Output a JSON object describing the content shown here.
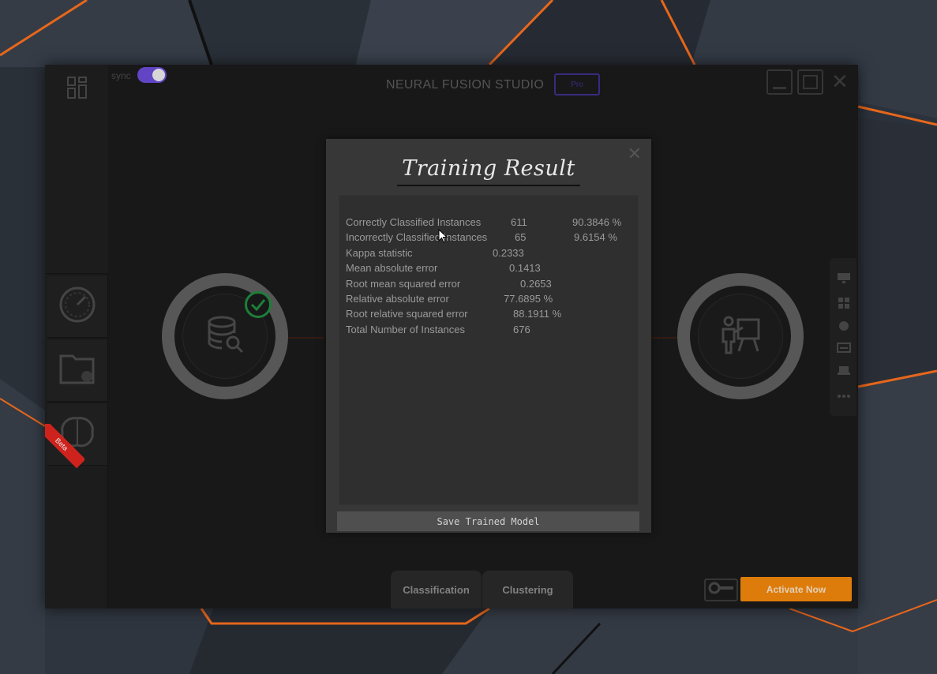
{
  "app": {
    "title": "NEURAL FUSION STUDIO",
    "badge": "Pro",
    "sync_label": "sync",
    "sync_on": true
  },
  "sidebar": {
    "beta_label": "Beta",
    "icons": [
      "apps-grid-icon",
      "speedometer-icon",
      "folder-chart-icon",
      "brain-icon"
    ]
  },
  "dialog": {
    "title": "Training Result",
    "close_symbol": "✕",
    "save_button": "Save Trained Model",
    "results": [
      {
        "label": "Correctly Classified Instances",
        "value": "611",
        "percent": "90.3846 %"
      },
      {
        "label": "Incorrectly Classified Instances",
        "value": "65",
        "percent": "9.6154 %"
      },
      {
        "label": "Kappa statistic",
        "value": "0.2333",
        "percent": ""
      },
      {
        "label": "Mean absolute error",
        "value": "0.1413",
        "percent": ""
      },
      {
        "label": "Root mean squared error",
        "value": "0.2653",
        "percent": ""
      },
      {
        "label": "Relative absolute error",
        "value": "77.6895 %",
        "percent": ""
      },
      {
        "label": "Root relative squared error",
        "value": "88.1911 %",
        "percent": ""
      },
      {
        "label": "Total Number of Instances",
        "value": "676",
        "percent": ""
      }
    ]
  },
  "bottom_tabs": {
    "classification": "Classification",
    "clustering": "Clustering"
  },
  "activate_button": "Activate Now",
  "colors": {
    "accent_orange": "#f0870d",
    "toggle_purple": "#6b4bd6",
    "success_green": "#1f8a3e"
  }
}
